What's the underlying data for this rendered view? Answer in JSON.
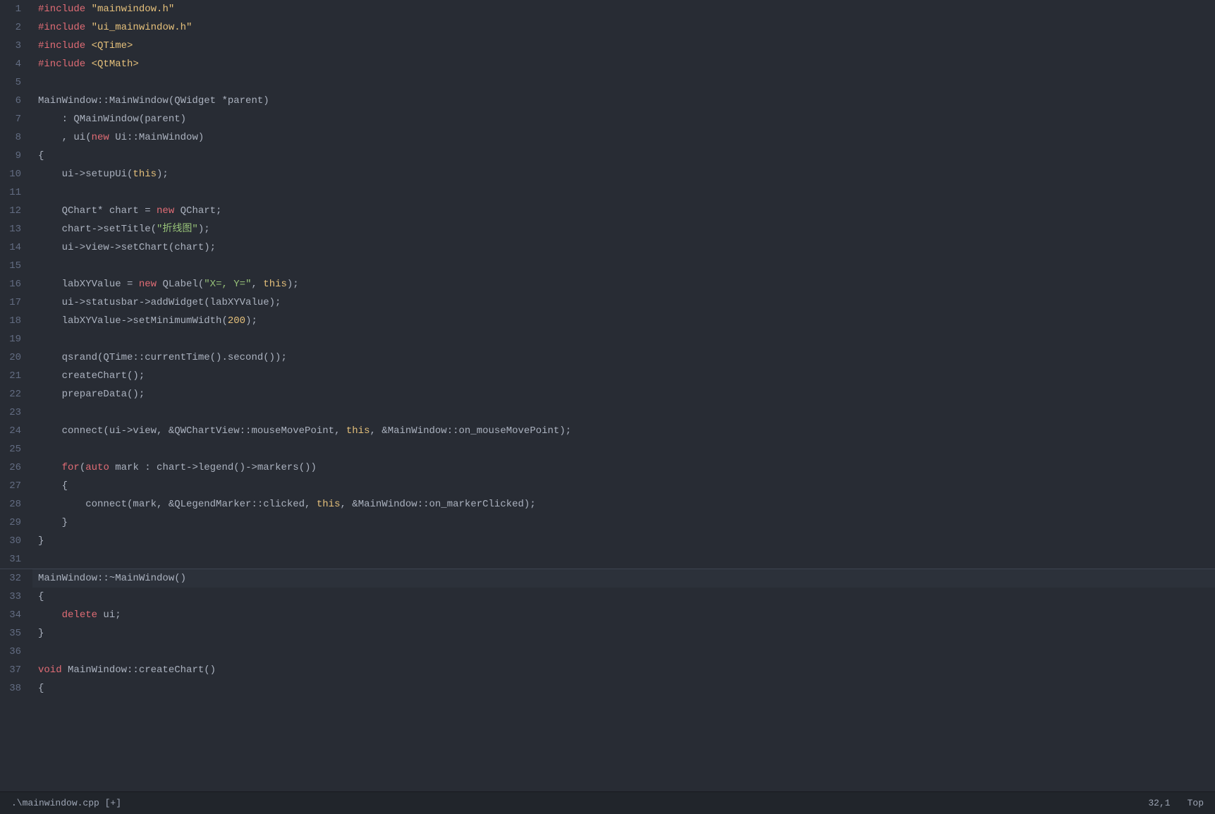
{
  "editor": {
    "filename": ".\\mainwindow.cpp [+]",
    "cursor_position": "32,1",
    "scroll_position": "Top",
    "lines": [
      {
        "num": 1,
        "content": "#include \"mainwindow.h\"",
        "tokens": [
          {
            "text": "#include ",
            "class": "kw-include"
          },
          {
            "text": "\"mainwindow.h\"",
            "class": "str-include"
          }
        ]
      },
      {
        "num": 2,
        "content": "#include \"ui_mainwindow.h\"",
        "tokens": [
          {
            "text": "#include ",
            "class": "kw-include"
          },
          {
            "text": "\"ui_mainwindow.h\"",
            "class": "str-include"
          }
        ]
      },
      {
        "num": 3,
        "content": "#include <QTime>",
        "tokens": [
          {
            "text": "#include ",
            "class": "kw-include"
          },
          {
            "text": "<QTime>",
            "class": "str-include"
          }
        ]
      },
      {
        "num": 4,
        "content": "#include <QtMath>",
        "tokens": [
          {
            "text": "#include ",
            "class": "kw-include"
          },
          {
            "text": "<QtMath>",
            "class": "str-include"
          }
        ]
      },
      {
        "num": 5,
        "content": "",
        "tokens": []
      },
      {
        "num": 6,
        "content": "MainWindow::MainWindow(QWidget *parent)",
        "tokens": [
          {
            "text": "MainWindow::MainWindow(QWidget *parent)",
            "class": "plain"
          }
        ]
      },
      {
        "num": 7,
        "content": "    : QMainWindow(parent)",
        "tokens": [
          {
            "text": "    : QMainWindow(parent)",
            "class": "plain"
          }
        ]
      },
      {
        "num": 8,
        "content": "    , ui(new Ui::MainWindow)",
        "tokens": [
          {
            "text": "    , ui(",
            "class": "plain"
          },
          {
            "text": "new",
            "class": "kw-new"
          },
          {
            "text": " Ui::MainWindow)",
            "class": "plain"
          }
        ]
      },
      {
        "num": 9,
        "content": "{",
        "tokens": [
          {
            "text": "{",
            "class": "plain"
          }
        ]
      },
      {
        "num": 10,
        "content": "    ui->setupUi(this);",
        "tokens": [
          {
            "text": "    ui->setupUi(",
            "class": "plain"
          },
          {
            "text": "this",
            "class": "kw-this"
          },
          {
            "text": ");",
            "class": "plain"
          }
        ]
      },
      {
        "num": 11,
        "content": "",
        "tokens": []
      },
      {
        "num": 12,
        "content": "    QChart* chart = new QChart;",
        "tokens": [
          {
            "text": "    QChart* chart = ",
            "class": "plain"
          },
          {
            "text": "new",
            "class": "kw-new"
          },
          {
            "text": " QChart;",
            "class": "plain"
          }
        ]
      },
      {
        "num": 13,
        "content": "    chart->setTitle(\"折线图\");",
        "tokens": [
          {
            "text": "    chart->setTitle(",
            "class": "plain"
          },
          {
            "text": "\"折线图\"",
            "class": "str-literal"
          },
          {
            "text": ");",
            "class": "plain"
          }
        ]
      },
      {
        "num": 14,
        "content": "    ui->view->setChart(chart);",
        "tokens": [
          {
            "text": "    ui->view->setChart(chart);",
            "class": "plain"
          }
        ]
      },
      {
        "num": 15,
        "content": "",
        "tokens": []
      },
      {
        "num": 16,
        "content": "    labXYValue = new QLabel(\"X=, Y=\", this);",
        "tokens": [
          {
            "text": "    labXYValue = ",
            "class": "plain"
          },
          {
            "text": "new",
            "class": "kw-new"
          },
          {
            "text": " QLabel(",
            "class": "plain"
          },
          {
            "text": "\"X=, Y=\"",
            "class": "str-literal"
          },
          {
            "text": ", ",
            "class": "plain"
          },
          {
            "text": "this",
            "class": "kw-this"
          },
          {
            "text": ");",
            "class": "plain"
          }
        ]
      },
      {
        "num": 17,
        "content": "    ui->statusbar->addWidget(labXYValue);",
        "tokens": [
          {
            "text": "    ui->statusbar->addWidget(labXYValue);",
            "class": "plain"
          }
        ]
      },
      {
        "num": 18,
        "content": "    labXYValue->setMinimumWidth(200);",
        "tokens": [
          {
            "text": "    labXYValue->setMinimumWidth(",
            "class": "plain"
          },
          {
            "text": "200",
            "class": "num-literal"
          },
          {
            "text": ");",
            "class": "plain"
          }
        ]
      },
      {
        "num": 19,
        "content": "",
        "tokens": []
      },
      {
        "num": 20,
        "content": "    qsrand(QTime::currentTime().second());",
        "tokens": [
          {
            "text": "    qsrand(QTime::currentTime().second());",
            "class": "plain"
          }
        ]
      },
      {
        "num": 21,
        "content": "    createChart();",
        "tokens": [
          {
            "text": "    createChart();",
            "class": "plain"
          }
        ]
      },
      {
        "num": 22,
        "content": "    prepareData();",
        "tokens": [
          {
            "text": "    prepareData();",
            "class": "plain"
          }
        ]
      },
      {
        "num": 23,
        "content": "",
        "tokens": []
      },
      {
        "num": 24,
        "content": "    connect(ui->view, &QWChartView::mouseMovePoint, this, &MainWindow::on_mouseMovePoint);",
        "tokens": [
          {
            "text": "    connect(ui->view, &QWChartView::mouseMovePoint, ",
            "class": "plain"
          },
          {
            "text": "this",
            "class": "kw-this"
          },
          {
            "text": ", &MainWindow::on_mouseMovePoint);",
            "class": "plain"
          }
        ]
      },
      {
        "num": 25,
        "content": "",
        "tokens": []
      },
      {
        "num": 26,
        "content": "    for(auto mark : chart->legend()->markers())",
        "tokens": [
          {
            "text": "    ",
            "class": "plain"
          },
          {
            "text": "for",
            "class": "kw-type"
          },
          {
            "text": "(",
            "class": "plain"
          },
          {
            "text": "auto",
            "class": "kw-auto"
          },
          {
            "text": " mark : chart->legend()->markers())",
            "class": "plain"
          }
        ]
      },
      {
        "num": 27,
        "content": "    {",
        "tokens": [
          {
            "text": "    {",
            "class": "plain"
          }
        ]
      },
      {
        "num": 28,
        "content": "        connect(mark, &QLegendMarker::clicked, this, &MainWindow::on_markerClicked);",
        "tokens": [
          {
            "text": "        connect(mark, &QLegendMarker::clicked, ",
            "class": "plain"
          },
          {
            "text": "this",
            "class": "kw-this"
          },
          {
            "text": ", &MainWindow::on_markerClicked);",
            "class": "plain"
          }
        ]
      },
      {
        "num": 29,
        "content": "    }",
        "tokens": [
          {
            "text": "    }",
            "class": "plain"
          }
        ]
      },
      {
        "num": 30,
        "content": "}",
        "tokens": [
          {
            "text": "}",
            "class": "plain"
          }
        ]
      },
      {
        "num": 31,
        "content": "",
        "tokens": []
      },
      {
        "num": 32,
        "content": "MainWindow::~MainWindow()",
        "tokens": [
          {
            "text": "MainWindow::~MainWindow()",
            "class": "plain"
          }
        ],
        "current": true
      },
      {
        "num": 33,
        "content": "{",
        "tokens": [
          {
            "text": "{",
            "class": "plain"
          }
        ]
      },
      {
        "num": 34,
        "content": "    delete ui;",
        "tokens": [
          {
            "text": "    ",
            "class": "plain"
          },
          {
            "text": "delete",
            "class": "kw-delete"
          },
          {
            "text": " ui;",
            "class": "plain"
          }
        ]
      },
      {
        "num": 35,
        "content": "}",
        "tokens": [
          {
            "text": "}",
            "class": "plain"
          }
        ]
      },
      {
        "num": 36,
        "content": "",
        "tokens": []
      },
      {
        "num": 37,
        "content": "void MainWindow::createChart()",
        "tokens": [
          {
            "text": "",
            "class": "plain"
          },
          {
            "text": "void",
            "class": "kw-type"
          },
          {
            "text": " MainWindow::createChart()",
            "class": "plain"
          }
        ]
      },
      {
        "num": 38,
        "content": "{",
        "tokens": [
          {
            "text": "{",
            "class": "plain"
          }
        ]
      }
    ]
  },
  "statusbar": {
    "filename": ".\\mainwindow.cpp [+]",
    "cursor": "32,1",
    "scroll": "Top"
  }
}
